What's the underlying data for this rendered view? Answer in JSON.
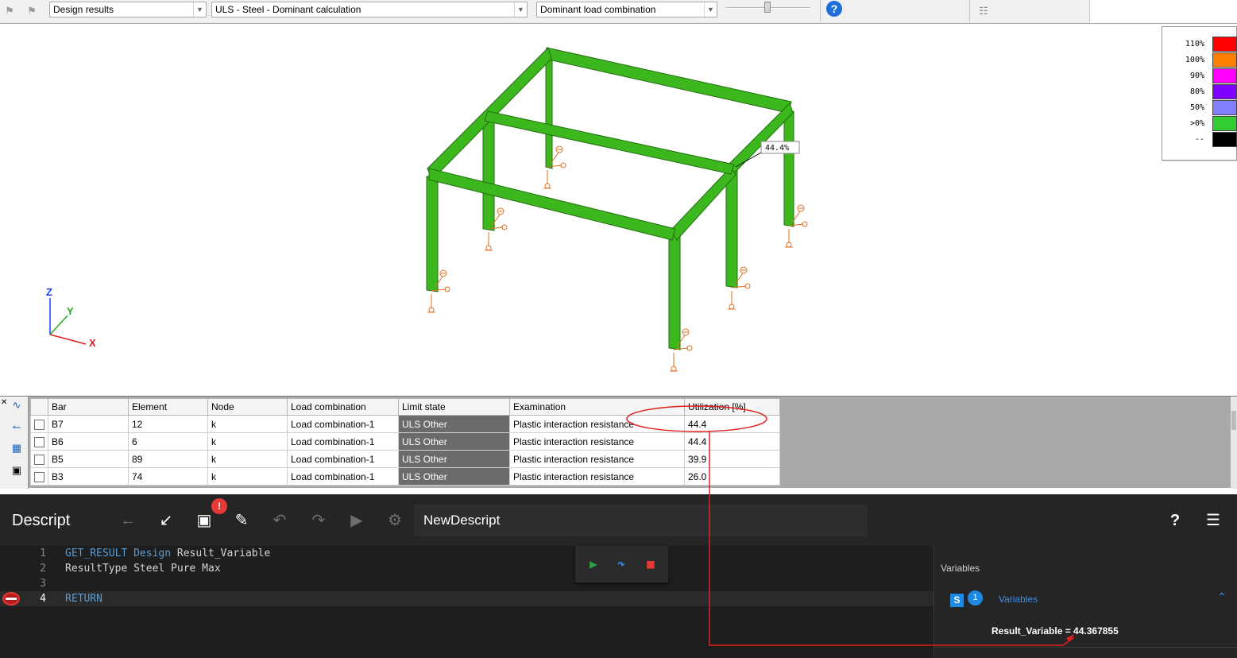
{
  "toolbar": {
    "result_select": "Design results",
    "calc_select": "ULS - Steel - Dominant calculation",
    "combo_select": "Dominant load combination",
    "help_label": "?"
  },
  "view": {
    "utilization_label": "44.4%",
    "axes": {
      "z": "Z",
      "y": "Y",
      "x": "X"
    }
  },
  "legend": [
    {
      "label": "110%",
      "color": "#ff0000"
    },
    {
      "label": "100%",
      "color": "#ff8000"
    },
    {
      "label": "90%",
      "color": "#ff00ff"
    },
    {
      "label": "80%",
      "color": "#8000ff"
    },
    {
      "label": "50%",
      "color": "#8080ff"
    },
    {
      "label": ">0%",
      "color": "#33cc33"
    },
    {
      "label": "--",
      "color": "#000000"
    }
  ],
  "table": {
    "headers": [
      "Bar",
      "Element",
      "Node",
      "Load combination",
      "Limit state",
      "Examination",
      "Utilization [%]"
    ],
    "rows": [
      {
        "bar": "B7",
        "element": "12",
        "node": "k",
        "combo": "Load combination-1",
        "limit": "ULS Other",
        "exam": "Plastic interaction resistance",
        "util": "44.4"
      },
      {
        "bar": "B6",
        "element": "6",
        "node": "k",
        "combo": "Load combination-1",
        "limit": "ULS Other",
        "exam": "Plastic interaction resistance",
        "util": "44.4"
      },
      {
        "bar": "B5",
        "element": "89",
        "node": "k",
        "combo": "Load combination-1",
        "limit": "ULS Other",
        "exam": "Plastic interaction resistance",
        "util": "39.9"
      },
      {
        "bar": "B3",
        "element": "74",
        "node": "k",
        "combo": "Load combination-1",
        "limit": "ULS Other",
        "exam": "Plastic interaction resistance",
        "util": "26.0"
      }
    ]
  },
  "descript": {
    "title": "Descript",
    "badge": "!",
    "script_name": "NewDescript",
    "help": "?",
    "code": {
      "l1_kw": "GET_RESULT Design",
      "l1_rest": " Result_Variable",
      "l2": "ResultType Steel Pure Max",
      "l3": "",
      "l4_kw": "RETURN"
    },
    "line_numbers": [
      "1",
      "2",
      "3",
      "4"
    ],
    "variables_title": "Variables",
    "scope_badge": "S",
    "count_badge": "1",
    "variables_group": "Variables",
    "result_text": "Result_Variable = 44.367855"
  }
}
